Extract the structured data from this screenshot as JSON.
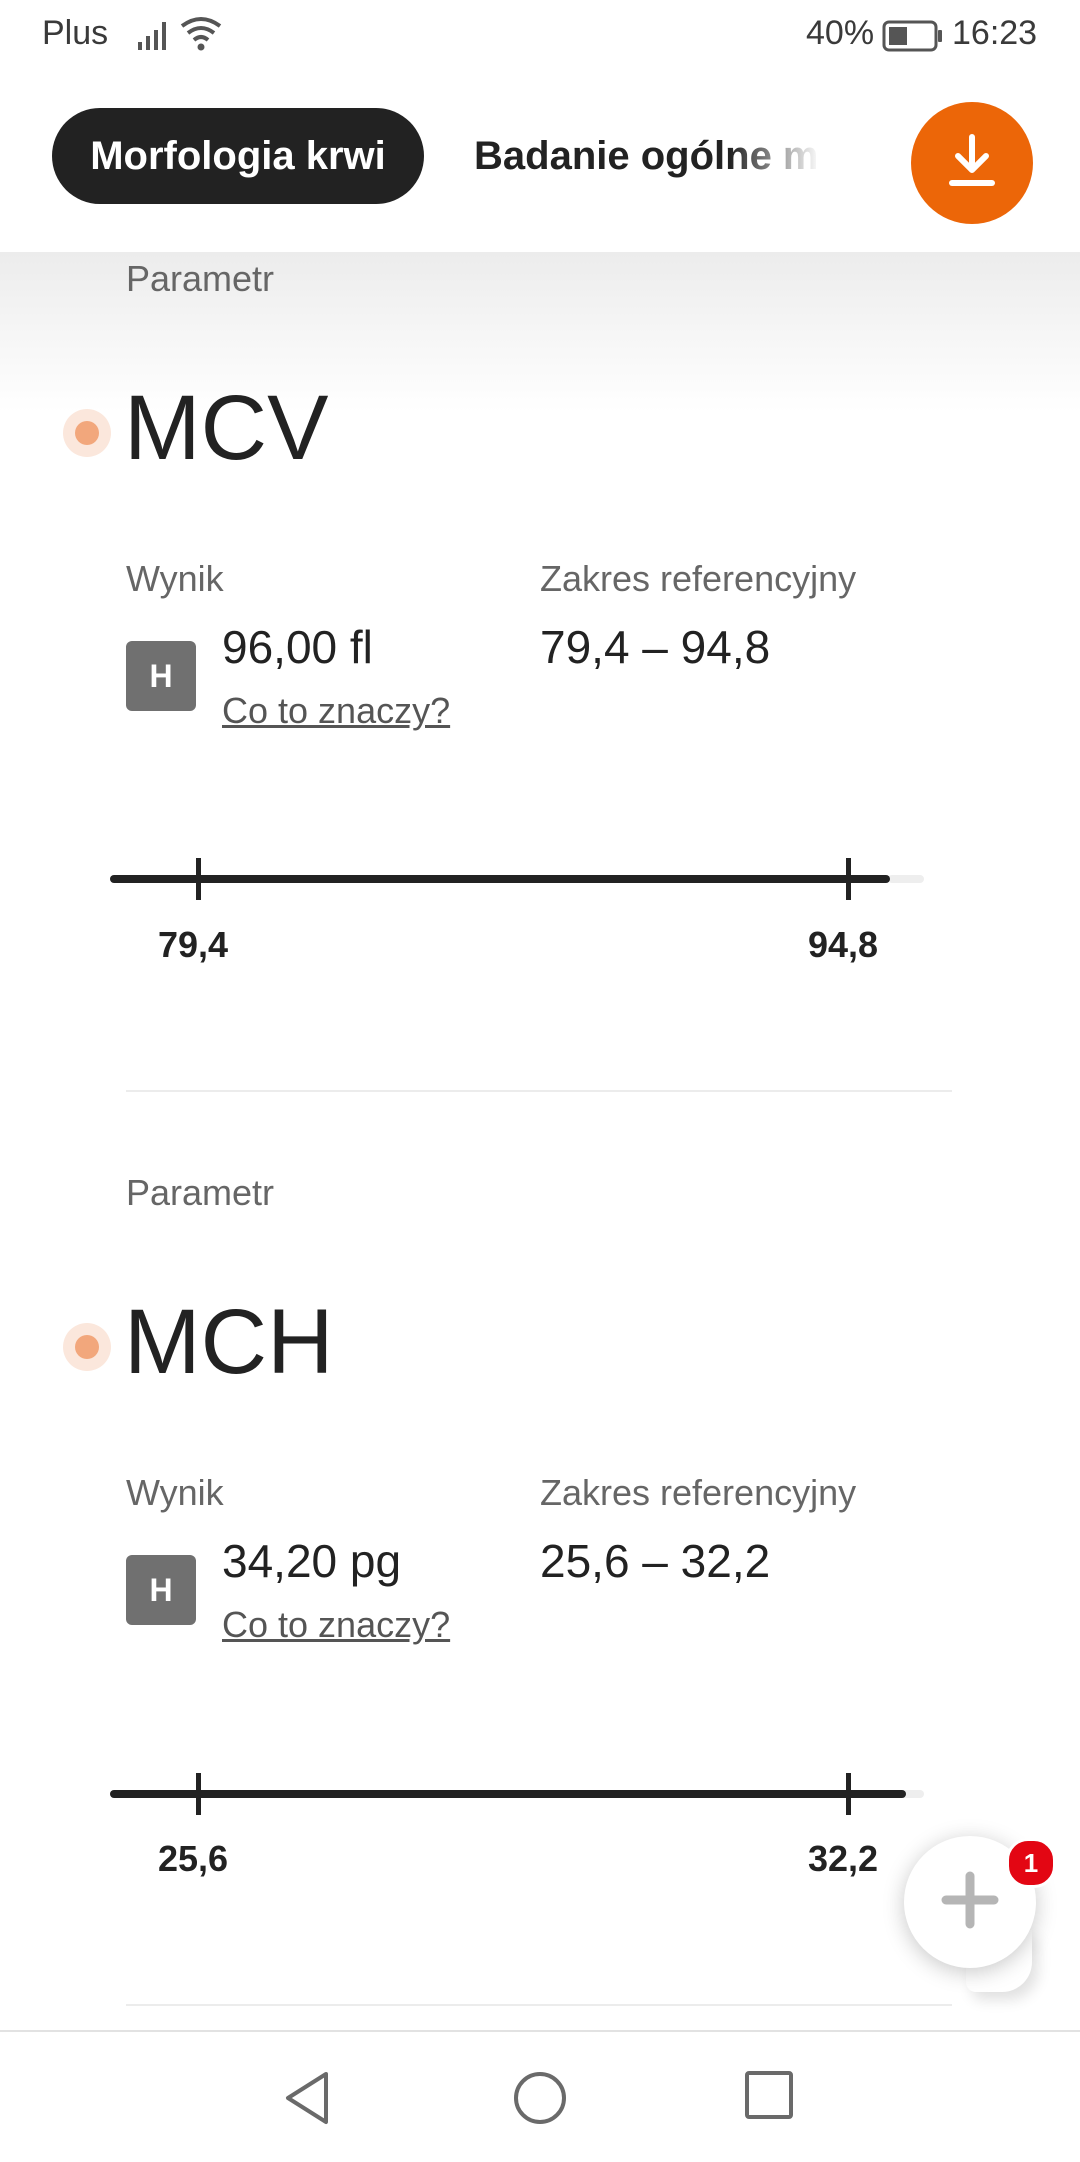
{
  "status_bar": {
    "carrier": "Plus",
    "battery_percent": "40%",
    "time": "16:23",
    "icons": [
      "signal-icon",
      "wifi-icon",
      "battery-icon"
    ]
  },
  "tabs": {
    "items": [
      {
        "label": "Morfologia krwi",
        "active": true
      },
      {
        "label": "Badanie ogólne moczu",
        "active": false
      }
    ]
  },
  "download_icon": "download-icon",
  "parameters": [
    {
      "section_label": "Parametr",
      "name": "MCV",
      "result_label": "Wynik",
      "flag": "H",
      "value": "96,00 fl",
      "link": "Co to znaczy?",
      "reference_label": "Zakres referencyjny",
      "reference_range": "79,4 – 94,8",
      "range_min_label": "79,4",
      "range_max_label": "94,8"
    },
    {
      "section_label": "Parametr",
      "name": "MCH",
      "result_label": "Wynik",
      "flag": "H",
      "value": "34,20 pg",
      "link": "Co to znaczy?",
      "reference_label": "Zakres referencyjny",
      "reference_range": "25,6 – 32,2",
      "range_min_label": "25,6",
      "range_max_label": "32,2"
    }
  ],
  "fab": {
    "badge": "1",
    "icon": "plus-icon"
  },
  "navbar": {
    "icons": [
      "back-icon",
      "home-icon",
      "recents-icon"
    ]
  },
  "colors": {
    "accent": "#ec6608",
    "dark": "#222222",
    "flag": "#707070",
    "badge": "#e30613"
  }
}
